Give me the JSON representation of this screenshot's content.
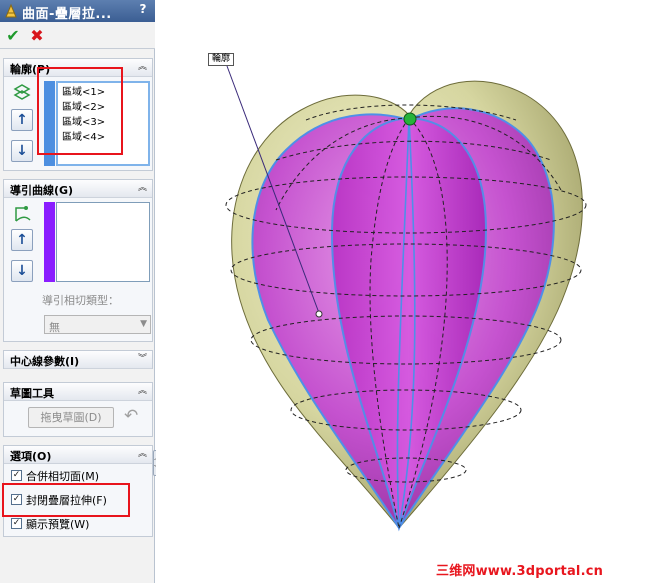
{
  "window": {
    "title": "曲面-疊層拉...",
    "help": "?",
    "ok": "✔",
    "cancel": "✖"
  },
  "profile_section": {
    "title": "輪廓(P)",
    "items": [
      "區域<1>",
      "區域<2>",
      "區域<3>",
      "區域<4>"
    ],
    "up": "↑",
    "down": "↓"
  },
  "guide_section": {
    "title": "導引曲線(G)",
    "tangency_label": "導引相切類型：",
    "tangency_value": "無",
    "up": "↑",
    "down": "↓"
  },
  "centerline_section": {
    "title": "中心線參數(I)"
  },
  "sketch_tools_section": {
    "title": "草圖工具",
    "drag_sketch_label": "拖曳草圖(D)",
    "undo": "↶"
  },
  "options_section": {
    "title": "選項(O)",
    "options": [
      {
        "label": "合併相切面(M)",
        "checked": true
      },
      {
        "label": "封閉疊層拉伸(F)",
        "checked": true
      },
      {
        "label": "顯示預覽(W)",
        "checked": true
      }
    ]
  },
  "viewport": {
    "callout_label": "輪廓",
    "watermark": "三维网www.3dportal.cn"
  },
  "colors": {
    "title_bar": "#4a6ea3",
    "profile_color_bar": "#4d8fe0",
    "guide_color_bar": "#8a1dff",
    "highlight_red": "#e8141c",
    "surface_magenta": "#c04ad0",
    "surface_gold": "#cfcf9a",
    "edge_blue": "#4f8fe8"
  }
}
